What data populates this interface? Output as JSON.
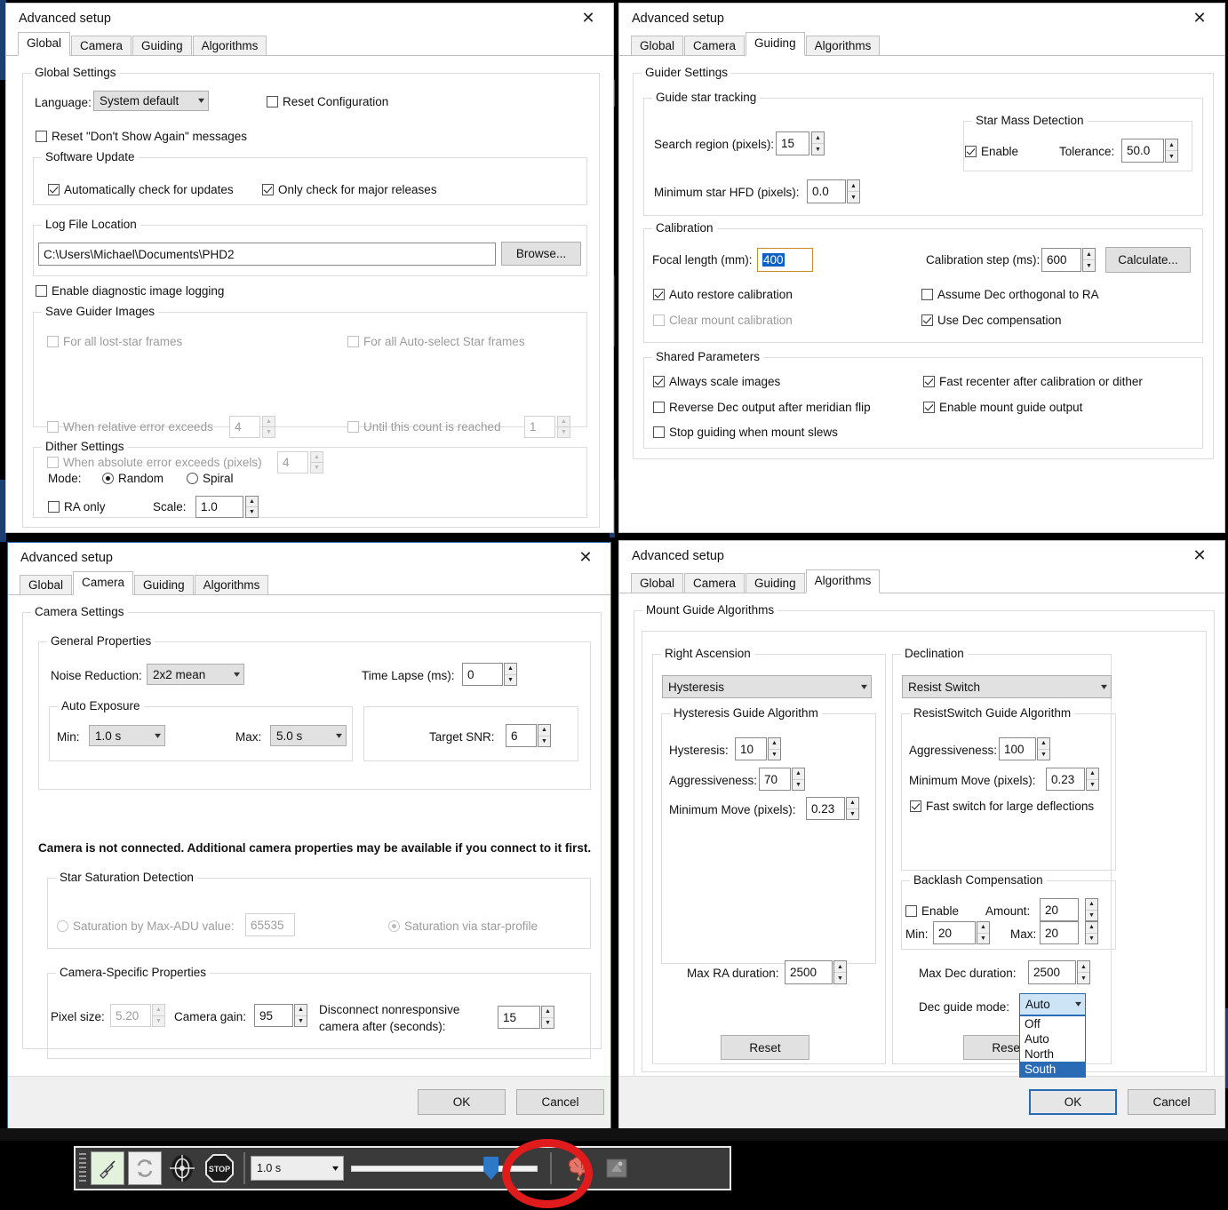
{
  "app": {
    "dialog_title": "Advanced setup",
    "close_icon": "close-icon"
  },
  "tabs": [
    "Global",
    "Camera",
    "Guiding",
    "Algorithms"
  ],
  "global_tab": {
    "selected_tab": "Global",
    "group_title": "Global Settings",
    "language_label": "Language:",
    "language_value": "System default",
    "reset_configuration": "Reset Configuration",
    "reset_dont_show": "Reset \"Don't Show Again\" messages",
    "software_update": {
      "title": "Software Update",
      "auto_check": "Automatically check for updates",
      "major_only": "Only check for major releases"
    },
    "log_file": {
      "title": "Log File Location",
      "path": "C:\\Users\\Michael\\Documents\\PHD2",
      "browse": "Browse..."
    },
    "enable_diag": "Enable diagnostic image logging",
    "save_guider": {
      "title": "Save Guider Images",
      "lost_star": "For all lost-star frames",
      "auto_select": "For all Auto-select Star frames",
      "relative_error": "When relative error exceeds",
      "relative_error_value": "4",
      "until_count": "Until this count is reached",
      "until_count_value": "1",
      "absolute_error": "When absolute error exceeds (pixels)",
      "absolute_error_value": "4"
    },
    "dither": {
      "title": "Dither Settings",
      "mode_label": "Mode:",
      "random": "Random",
      "spiral": "Spiral",
      "ra_only": "RA only",
      "scale_label": "Scale:",
      "scale_value": "1.0"
    }
  },
  "guiding_tab": {
    "selected_tab": "Guiding",
    "group_title": "Guider Settings",
    "tracking": {
      "title": "Guide star tracking",
      "search_region_label": "Search region (pixels):",
      "search_region_value": "15",
      "min_hfd_label": "Minimum star HFD (pixels):",
      "min_hfd_value": "0.0",
      "star_mass_title": "Star Mass Detection",
      "enable": "Enable",
      "tolerance_label": "Tolerance:",
      "tolerance_value": "50.0"
    },
    "calibration": {
      "title": "Calibration",
      "focal_length_label": "Focal length (mm):",
      "focal_length_value": "400",
      "cal_step_label": "Calibration step (ms):",
      "cal_step_value": "600",
      "calculate": "Calculate...",
      "auto_restore": "Auto restore calibration",
      "clear_mount": "Clear mount calibration",
      "assume_dec": "Assume Dec orthogonal to RA",
      "use_dec_comp": "Use Dec compensation"
    },
    "shared": {
      "title": "Shared Parameters",
      "always_scale": "Always scale images",
      "fast_recenter": "Fast recenter after calibration or dither",
      "reverse_dec": "Reverse Dec output after meridian flip",
      "enable_mount_output": "Enable mount guide output",
      "stop_guiding": "Stop guiding when mount slews"
    }
  },
  "camera_tab": {
    "selected_tab": "Camera",
    "group_title": "Camera Settings",
    "general": {
      "title": "General Properties",
      "noise_label": "Noise Reduction:",
      "noise_value": "2x2 mean",
      "time_lapse_label": "Time Lapse (ms):",
      "time_lapse_value": "0",
      "auto_exposure_title": "Auto Exposure",
      "min_label": "Min:",
      "min_value": "1.0 s",
      "max_label": "Max:",
      "max_value": "5.0 s",
      "target_snr_label": "Target SNR:",
      "target_snr_value": "6"
    },
    "notice": "Camera is not connected.  Additional camera properties may be available if you connect to it first.",
    "saturation": {
      "title": "Star Saturation Detection",
      "by_adu": "Saturation by Max-ADU value:",
      "adu_value": "65535",
      "via_profile": "Saturation via star-profile"
    },
    "specific": {
      "title": "Camera-Specific Properties",
      "pixel_size_label": "Pixel size:",
      "pixel_size_value": "5.20",
      "gain_label": "Camera gain:",
      "gain_value": "95",
      "disconnect_label_1": "Disconnect nonresponsive",
      "disconnect_label_2": "camera after (seconds):",
      "disconnect_value": "15"
    },
    "ok": "OK",
    "cancel": "Cancel"
  },
  "algorithms_tab": {
    "selected_tab": "Algorithms",
    "group_title": "Mount Guide Algorithms",
    "ra": {
      "title": "Right Ascension",
      "algorithm": "Hysteresis",
      "sub_title": "Hysteresis Guide Algorithm",
      "hysteresis_label": "Hysteresis:",
      "hysteresis_value": "10",
      "aggressiveness_label": "Aggressiveness:",
      "aggressiveness_value": "70",
      "min_move_label": "Minimum Move (pixels):",
      "min_move_value": "0.23",
      "max_duration_label": "Max RA duration:",
      "max_duration_value": "2500",
      "reset": "Reset"
    },
    "dec": {
      "title": "Declination",
      "algorithm": "Resist Switch",
      "sub_title": "ResistSwitch Guide Algorithm",
      "aggressiveness_label": "Aggressiveness:",
      "aggressiveness_value": "100",
      "min_move_label": "Minimum Move (pixels):",
      "min_move_value": "0.23",
      "fast_switch": "Fast switch for large deflections",
      "backlash": {
        "title": "Backlash Compensation",
        "enable": "Enable",
        "amount_label": "Amount:",
        "amount_value": "20",
        "min_label": "Min:",
        "min_value": "20",
        "max_label": "Max:",
        "max_value": "20"
      },
      "max_duration_label": "Max Dec duration:",
      "max_duration_value": "2500",
      "guide_mode_label": "Dec guide mode:",
      "guide_mode_value": "Auto",
      "guide_mode_options": [
        "Off",
        "Auto",
        "North",
        "South"
      ],
      "guide_mode_highlighted": "South",
      "reset": "Reset"
    },
    "ok": "OK",
    "cancel": "Cancel"
  },
  "toolbar": {
    "connect_icon": "connect-equipment-icon",
    "loop_icon": "loop-exposure-icon",
    "guide_icon": "guide-target-icon",
    "stop_icon": "stop-icon",
    "stop_label": "STOP",
    "exposure_value": "1.0 s",
    "brain_icon": "brain-advanced-settings-icon",
    "camera_icon": "camera-settings-icon",
    "annotation_icon": "red-circle-annotation"
  },
  "colors": {
    "accent": "#2b6ab5",
    "annotation_red": "#e01b1b",
    "selection_blue": "#0b61c4",
    "toolbar_bg": "#3a3a3a"
  }
}
